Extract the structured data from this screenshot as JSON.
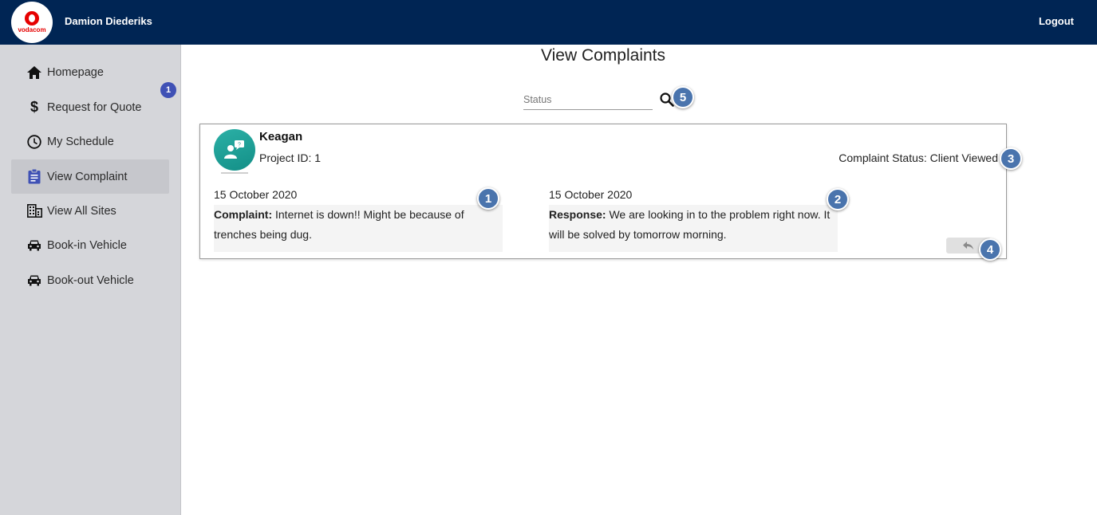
{
  "header": {
    "logo_text": "vodacom",
    "username": "Damion Diederiks",
    "logout_label": "Logout"
  },
  "sidebar": {
    "badge": "1",
    "items": [
      {
        "label": "Homepage",
        "icon": "home-icon"
      },
      {
        "label": "Request for Quote",
        "icon": "dollar-icon"
      },
      {
        "label": "My Schedule",
        "icon": "clock-icon"
      },
      {
        "label": "View Complaint",
        "icon": "clipboard-icon",
        "active": true
      },
      {
        "label": "View All Sites",
        "icon": "building-icon"
      },
      {
        "label": "Book-in Vehicle",
        "icon": "car-icon"
      },
      {
        "label": "Book-out Vehicle",
        "icon": "car-icon"
      }
    ]
  },
  "main": {
    "title": "View Complaints",
    "search": {
      "placeholder": "Status",
      "value": ""
    }
  },
  "complaint": {
    "client_name": "Keagan",
    "project_id": "Project ID: 1",
    "status": "Complaint Status: Client Viewed",
    "complaint_date": "15 October 2020",
    "complaint_label": "Complaint:",
    "complaint_text": " Internet is down!! Might be because of trenches being dug.",
    "response_date": "15 October 2020",
    "response_label": "Response:",
    "response_text": " We are looking in to the problem right now. It will be solved by tomorrow morning."
  },
  "callouts": [
    "1",
    "2",
    "3",
    "4",
    "5"
  ],
  "colors": {
    "topbar": "#002554",
    "sidebar": "#d5d6da",
    "callout": "#4a74ad",
    "badge": "#3f51b5",
    "brand_red": "#e60000",
    "avatar": "#1fa39a"
  }
}
